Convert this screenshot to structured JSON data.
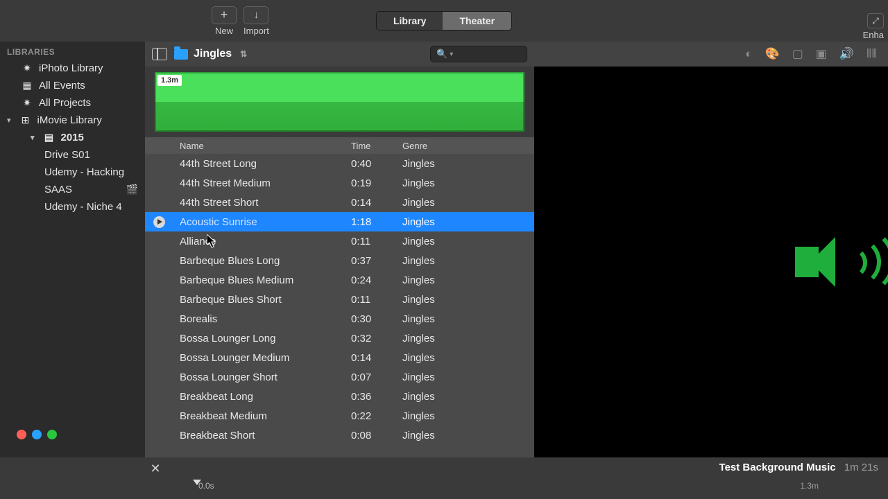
{
  "toolbar": {
    "new_label": "New",
    "import_label": "Import",
    "seg_library": "Library",
    "seg_theater": "Theater",
    "enhance_label": "Enha"
  },
  "sidebar": {
    "header": "LIBRARIES",
    "items": [
      {
        "label": "iPhoto Library",
        "glyph": "✷"
      },
      {
        "label": "All Events",
        "glyph": "▦"
      },
      {
        "label": "All Projects",
        "glyph": "✷"
      },
      {
        "label": "iMovie Library",
        "glyph": "⊞",
        "expanded": true
      },
      {
        "label": "2015",
        "glyph": "▤",
        "level": 2,
        "expanded": true
      },
      {
        "label": "Drive S01",
        "level": 3
      },
      {
        "label": "Udemy - Hacking",
        "level": 3
      },
      {
        "label": "SAAS",
        "level": 3,
        "clapper": true
      },
      {
        "label": "Udemy - Niche 4",
        "level": 3
      }
    ]
  },
  "browser": {
    "folder": "Jingles",
    "waveform_label": "1.3m",
    "columns": {
      "name": "Name",
      "time": "Time",
      "genre": "Genre"
    },
    "selected_index": 3,
    "tracks": [
      {
        "name": "44th Street Long",
        "time": "0:40",
        "genre": "Jingles"
      },
      {
        "name": "44th Street Medium",
        "time": "0:19",
        "genre": "Jingles"
      },
      {
        "name": "44th Street Short",
        "time": "0:14",
        "genre": "Jingles"
      },
      {
        "name": "Acoustic Sunrise",
        "time": "1:18",
        "genre": "Jingles"
      },
      {
        "name": "Alliance",
        "time": "0:11",
        "genre": "Jingles"
      },
      {
        "name": "Barbeque Blues Long",
        "time": "0:37",
        "genre": "Jingles"
      },
      {
        "name": "Barbeque Blues Medium",
        "time": "0:24",
        "genre": "Jingles"
      },
      {
        "name": "Barbeque Blues Short",
        "time": "0:11",
        "genre": "Jingles"
      },
      {
        "name": "Borealis",
        "time": "0:30",
        "genre": "Jingles"
      },
      {
        "name": "Bossa Lounger Long",
        "time": "0:32",
        "genre": "Jingles"
      },
      {
        "name": "Bossa Lounger Medium",
        "time": "0:14",
        "genre": "Jingles"
      },
      {
        "name": "Bossa Lounger Short",
        "time": "0:07",
        "genre": "Jingles"
      },
      {
        "name": "Breakbeat Long",
        "time": "0:36",
        "genre": "Jingles"
      },
      {
        "name": "Breakbeat Medium",
        "time": "0:22",
        "genre": "Jingles"
      },
      {
        "name": "Breakbeat Short",
        "time": "0:08",
        "genre": "Jingles"
      }
    ]
  },
  "project": {
    "title": "Test Background Music",
    "length": "1m 21s",
    "timeline_start": "0.0s",
    "timeline_end": "1.3m"
  },
  "colors": {
    "selection": "#1e86ff",
    "waveform": "#4be05b",
    "speaker": "#1fae3c"
  }
}
